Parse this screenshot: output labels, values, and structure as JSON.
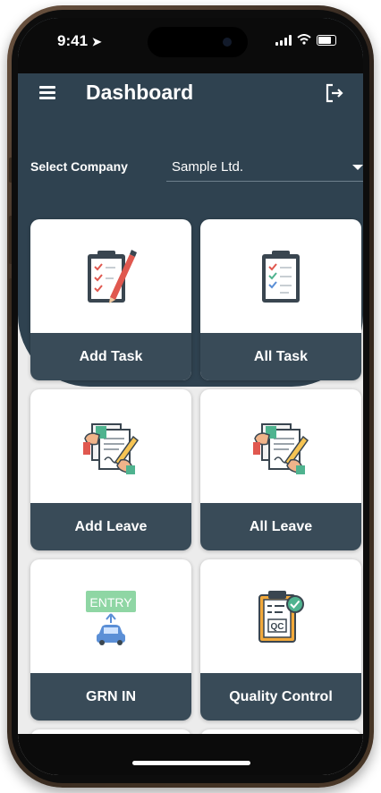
{
  "status": {
    "time": "9:41"
  },
  "header": {
    "title": "Dashboard"
  },
  "company": {
    "label": "Select Company",
    "value": "Sample Ltd."
  },
  "tiles": [
    {
      "label": "Add Task",
      "icon": "clipboard-pen-icon"
    },
    {
      "label": "All Task",
      "icon": "clipboard-checklist-icon"
    },
    {
      "label": "Add Leave",
      "icon": "document-sign-icon"
    },
    {
      "label": "All Leave",
      "icon": "document-sign-icon"
    },
    {
      "label": "GRN IN",
      "icon": "entry-sign-car-icon",
      "icon_text": "ENTRY"
    },
    {
      "label": "Quality Control",
      "icon": "qc-clipboard-icon",
      "icon_text": "QC"
    }
  ],
  "colors": {
    "header": "#2f4250",
    "tile_label_bg": "#394b58",
    "background": "#ececec"
  }
}
